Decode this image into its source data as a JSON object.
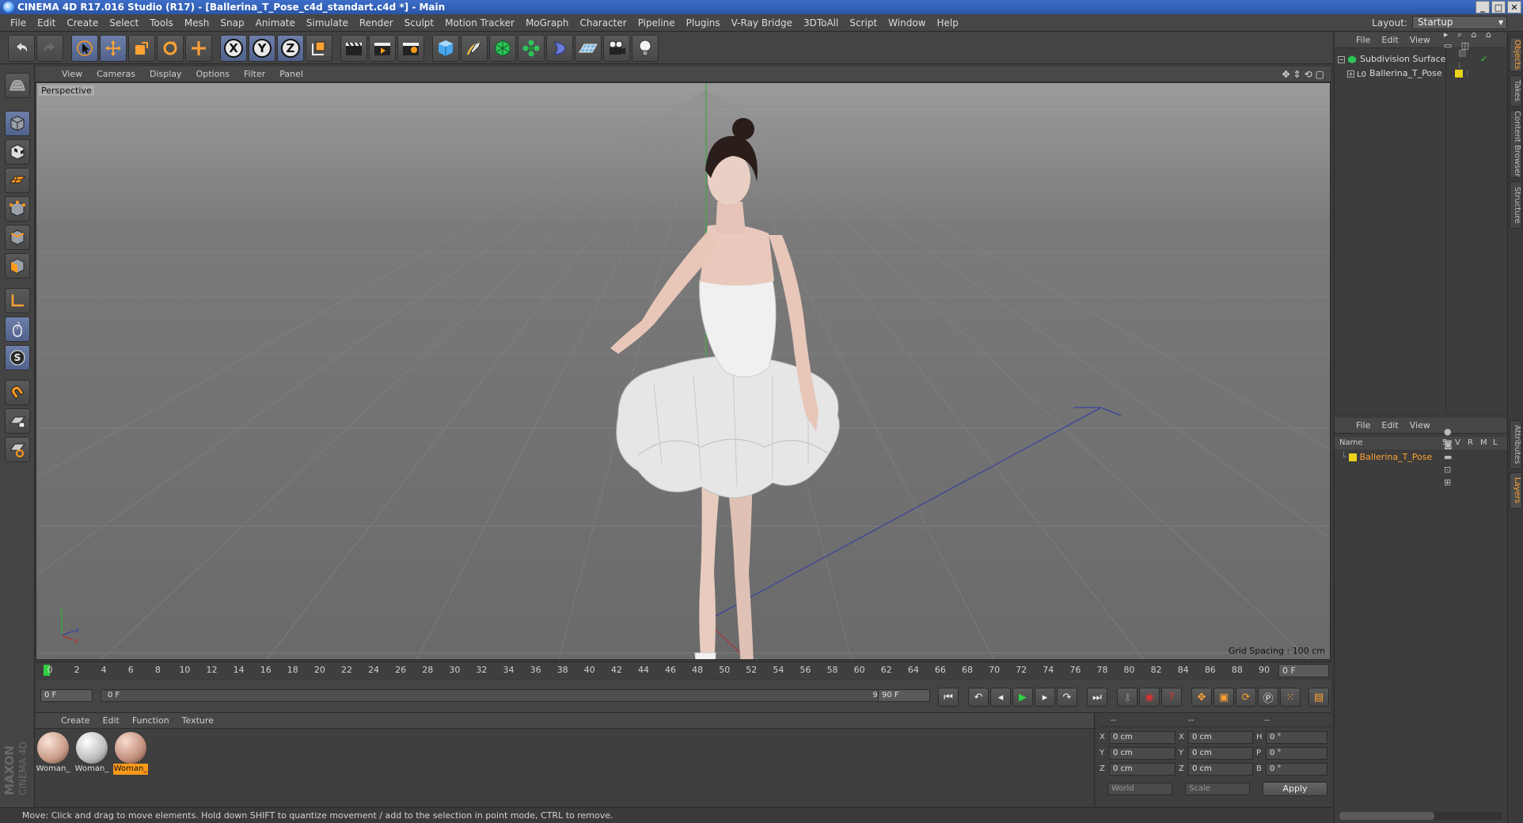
{
  "window": {
    "title": "CINEMA 4D R17.016 Studio (R17) - [Ballerina_T_Pose_c4d_standart.c4d *] - Main"
  },
  "menu": [
    "File",
    "Edit",
    "Create",
    "Select",
    "Tools",
    "Mesh",
    "Snap",
    "Animate",
    "Simulate",
    "Render",
    "Sculpt",
    "Motion Tracker",
    "MoGraph",
    "Character",
    "Pipeline",
    "Plugins",
    "V-Ray Bridge",
    "3DToAll",
    "Script",
    "Window",
    "Help"
  ],
  "layout": {
    "label": "Layout:",
    "value": "Startup"
  },
  "toolbar": {
    "axis_x": "X",
    "axis_y": "Y",
    "axis_z": "Z"
  },
  "viewport": {
    "menu": [
      "View",
      "Cameras",
      "Display",
      "Options",
      "Filter",
      "Panel"
    ],
    "label": "Perspective",
    "grid_spacing": "Grid Spacing : 100 cm",
    "axis_y": "y",
    "axis_z": "z",
    "axis_x": "x"
  },
  "timeline": {
    "ticks": [
      "0",
      "2",
      "4",
      "6",
      "8",
      "10",
      "12",
      "14",
      "16",
      "18",
      "20",
      "22",
      "24",
      "26",
      "28",
      "30",
      "32",
      "34",
      "36",
      "38",
      "40",
      "42",
      "44",
      "46",
      "48",
      "50",
      "52",
      "54",
      "56",
      "58",
      "60",
      "62",
      "64",
      "66",
      "68",
      "70",
      "72",
      "74",
      "76",
      "78",
      "80",
      "82",
      "84",
      "86",
      "88",
      "90"
    ],
    "current_frame": "0 F"
  },
  "transport": {
    "start_field": "0 F",
    "range_start": "0 F",
    "range_end": "90 F",
    "end_field": "90 F"
  },
  "materials": {
    "menu": [
      "Create",
      "Edit",
      "Function",
      "Texture"
    ],
    "items": [
      {
        "label": "Woman_",
        "selected": false
      },
      {
        "label": "Woman_",
        "selected": false
      },
      {
        "label": "Woman_",
        "selected": true
      }
    ]
  },
  "coords": {
    "header_dashes": [
      "--",
      "--",
      "--"
    ],
    "rows": [
      {
        "a": "X",
        "av": "0 cm",
        "b": "X",
        "bv": "0 cm",
        "c": "H",
        "cv": "0 °"
      },
      {
        "a": "Y",
        "av": "0 cm",
        "b": "Y",
        "bv": "0 cm",
        "c": "P",
        "cv": "0 °"
      },
      {
        "a": "Z",
        "av": "0 cm",
        "b": "Z",
        "bv": "0 cm",
        "c": "B",
        "cv": "0 °"
      }
    ],
    "world": "World",
    "scale": "Scale",
    "apply": "Apply"
  },
  "status": "Move: Click and drag to move elements. Hold down SHIFT to quantize movement / add to the selection in point mode, CTRL to remove.",
  "object_manager": {
    "menu": [
      "File",
      "Edit",
      "View"
    ],
    "objects": [
      {
        "name": "Subdivision Surface"
      },
      {
        "name": "Ballerina_T_Pose"
      }
    ]
  },
  "layer_manager": {
    "menu": [
      "File",
      "Edit",
      "View"
    ],
    "columns": {
      "name": "Name",
      "s": "S",
      "v": "V",
      "r": "R",
      "m": "M",
      "l": "L"
    },
    "layers": [
      {
        "name": "Ballerina_T_Pose",
        "color": "#e8d21a"
      }
    ]
  },
  "side_tabs": [
    "Objects",
    "Takes",
    "Content Browser",
    "Structure",
    "Attributes",
    "Layers"
  ],
  "logo": {
    "line1": "MAXON",
    "line2": "CINEMA 4D"
  },
  "colors": {
    "accent": "#ff9a1a",
    "selection": "#ffa233",
    "playhead": "#31d041"
  }
}
